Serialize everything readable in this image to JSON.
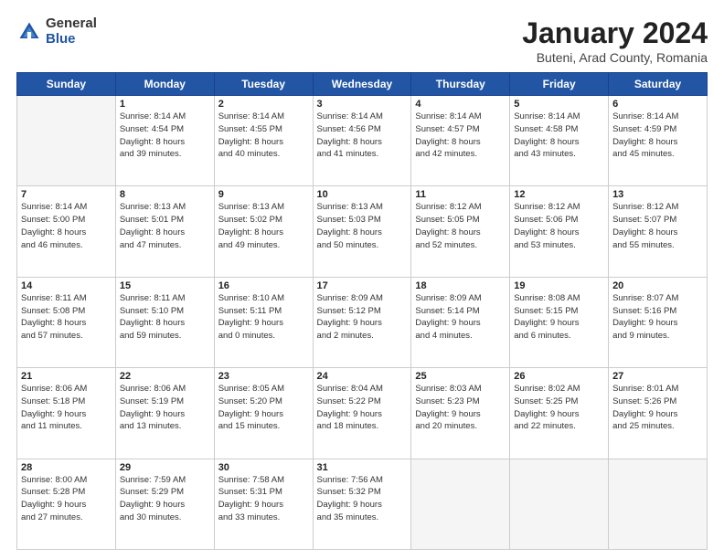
{
  "header": {
    "logo": {
      "general": "General",
      "blue": "Blue"
    },
    "title": "January 2024",
    "location": "Buteni, Arad County, Romania"
  },
  "weekdays": [
    "Sunday",
    "Monday",
    "Tuesday",
    "Wednesday",
    "Thursday",
    "Friday",
    "Saturday"
  ],
  "weeks": [
    [
      {
        "day": "",
        "empty": true
      },
      {
        "day": "1",
        "sunrise": "Sunrise: 8:14 AM",
        "sunset": "Sunset: 4:54 PM",
        "daylight": "Daylight: 8 hours and 39 minutes."
      },
      {
        "day": "2",
        "sunrise": "Sunrise: 8:14 AM",
        "sunset": "Sunset: 4:55 PM",
        "daylight": "Daylight: 8 hours and 40 minutes."
      },
      {
        "day": "3",
        "sunrise": "Sunrise: 8:14 AM",
        "sunset": "Sunset: 4:56 PM",
        "daylight": "Daylight: 8 hours and 41 minutes."
      },
      {
        "day": "4",
        "sunrise": "Sunrise: 8:14 AM",
        "sunset": "Sunset: 4:57 PM",
        "daylight": "Daylight: 8 hours and 42 minutes."
      },
      {
        "day": "5",
        "sunrise": "Sunrise: 8:14 AM",
        "sunset": "Sunset: 4:58 PM",
        "daylight": "Daylight: 8 hours and 43 minutes."
      },
      {
        "day": "6",
        "sunrise": "Sunrise: 8:14 AM",
        "sunset": "Sunset: 4:59 PM",
        "daylight": "Daylight: 8 hours and 45 minutes."
      }
    ],
    [
      {
        "day": "7",
        "sunrise": "Sunrise: 8:14 AM",
        "sunset": "Sunset: 5:00 PM",
        "daylight": "Daylight: 8 hours and 46 minutes."
      },
      {
        "day": "8",
        "sunrise": "Sunrise: 8:13 AM",
        "sunset": "Sunset: 5:01 PM",
        "daylight": "Daylight: 8 hours and 47 minutes."
      },
      {
        "day": "9",
        "sunrise": "Sunrise: 8:13 AM",
        "sunset": "Sunset: 5:02 PM",
        "daylight": "Daylight: 8 hours and 49 minutes."
      },
      {
        "day": "10",
        "sunrise": "Sunrise: 8:13 AM",
        "sunset": "Sunset: 5:03 PM",
        "daylight": "Daylight: 8 hours and 50 minutes."
      },
      {
        "day": "11",
        "sunrise": "Sunrise: 8:12 AM",
        "sunset": "Sunset: 5:05 PM",
        "daylight": "Daylight: 8 hours and 52 minutes."
      },
      {
        "day": "12",
        "sunrise": "Sunrise: 8:12 AM",
        "sunset": "Sunset: 5:06 PM",
        "daylight": "Daylight: 8 hours and 53 minutes."
      },
      {
        "day": "13",
        "sunrise": "Sunrise: 8:12 AM",
        "sunset": "Sunset: 5:07 PM",
        "daylight": "Daylight: 8 hours and 55 minutes."
      }
    ],
    [
      {
        "day": "14",
        "sunrise": "Sunrise: 8:11 AM",
        "sunset": "Sunset: 5:08 PM",
        "daylight": "Daylight: 8 hours and 57 minutes."
      },
      {
        "day": "15",
        "sunrise": "Sunrise: 8:11 AM",
        "sunset": "Sunset: 5:10 PM",
        "daylight": "Daylight: 8 hours and 59 minutes."
      },
      {
        "day": "16",
        "sunrise": "Sunrise: 8:10 AM",
        "sunset": "Sunset: 5:11 PM",
        "daylight": "Daylight: 9 hours and 0 minutes."
      },
      {
        "day": "17",
        "sunrise": "Sunrise: 8:09 AM",
        "sunset": "Sunset: 5:12 PM",
        "daylight": "Daylight: 9 hours and 2 minutes."
      },
      {
        "day": "18",
        "sunrise": "Sunrise: 8:09 AM",
        "sunset": "Sunset: 5:14 PM",
        "daylight": "Daylight: 9 hours and 4 minutes."
      },
      {
        "day": "19",
        "sunrise": "Sunrise: 8:08 AM",
        "sunset": "Sunset: 5:15 PM",
        "daylight": "Daylight: 9 hours and 6 minutes."
      },
      {
        "day": "20",
        "sunrise": "Sunrise: 8:07 AM",
        "sunset": "Sunset: 5:16 PM",
        "daylight": "Daylight: 9 hours and 9 minutes."
      }
    ],
    [
      {
        "day": "21",
        "sunrise": "Sunrise: 8:06 AM",
        "sunset": "Sunset: 5:18 PM",
        "daylight": "Daylight: 9 hours and 11 minutes."
      },
      {
        "day": "22",
        "sunrise": "Sunrise: 8:06 AM",
        "sunset": "Sunset: 5:19 PM",
        "daylight": "Daylight: 9 hours and 13 minutes."
      },
      {
        "day": "23",
        "sunrise": "Sunrise: 8:05 AM",
        "sunset": "Sunset: 5:20 PM",
        "daylight": "Daylight: 9 hours and 15 minutes."
      },
      {
        "day": "24",
        "sunrise": "Sunrise: 8:04 AM",
        "sunset": "Sunset: 5:22 PM",
        "daylight": "Daylight: 9 hours and 18 minutes."
      },
      {
        "day": "25",
        "sunrise": "Sunrise: 8:03 AM",
        "sunset": "Sunset: 5:23 PM",
        "daylight": "Daylight: 9 hours and 20 minutes."
      },
      {
        "day": "26",
        "sunrise": "Sunrise: 8:02 AM",
        "sunset": "Sunset: 5:25 PM",
        "daylight": "Daylight: 9 hours and 22 minutes."
      },
      {
        "day": "27",
        "sunrise": "Sunrise: 8:01 AM",
        "sunset": "Sunset: 5:26 PM",
        "daylight": "Daylight: 9 hours and 25 minutes."
      }
    ],
    [
      {
        "day": "28",
        "sunrise": "Sunrise: 8:00 AM",
        "sunset": "Sunset: 5:28 PM",
        "daylight": "Daylight: 9 hours and 27 minutes."
      },
      {
        "day": "29",
        "sunrise": "Sunrise: 7:59 AM",
        "sunset": "Sunset: 5:29 PM",
        "daylight": "Daylight: 9 hours and 30 minutes."
      },
      {
        "day": "30",
        "sunrise": "Sunrise: 7:58 AM",
        "sunset": "Sunset: 5:31 PM",
        "daylight": "Daylight: 9 hours and 33 minutes."
      },
      {
        "day": "31",
        "sunrise": "Sunrise: 7:56 AM",
        "sunset": "Sunset: 5:32 PM",
        "daylight": "Daylight: 9 hours and 35 minutes."
      },
      {
        "day": "",
        "empty": true
      },
      {
        "day": "",
        "empty": true
      },
      {
        "day": "",
        "empty": true
      }
    ]
  ]
}
